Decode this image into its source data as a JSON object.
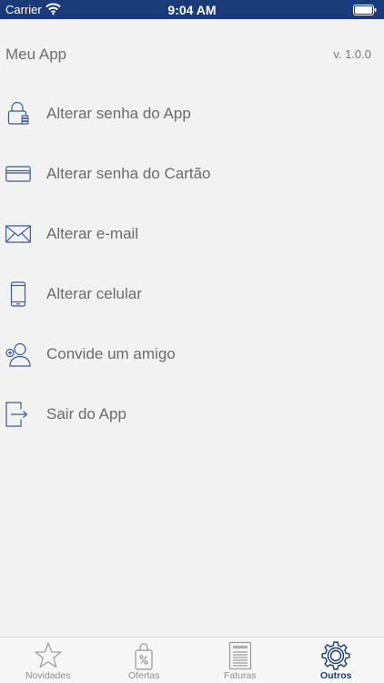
{
  "status_bar": {
    "carrier": "Carrier",
    "time": "9:04 AM"
  },
  "header": {
    "title": "Meu App",
    "version": "v. 1.0.0"
  },
  "menu": {
    "items": [
      {
        "label": "Alterar senha do App",
        "icon": "lock-icon"
      },
      {
        "label": "Alterar senha do Cartão",
        "icon": "credit-card-icon"
      },
      {
        "label": "Alterar e-mail",
        "icon": "envelope-icon"
      },
      {
        "label": "Alterar celular",
        "icon": "smartphone-icon"
      },
      {
        "label": "Convide um amigo",
        "icon": "add-user-icon"
      },
      {
        "label": "Sair do App",
        "icon": "logout-icon"
      }
    ]
  },
  "tab_bar": {
    "tabs": [
      {
        "label": "Novidades",
        "icon": "star-icon",
        "active": false
      },
      {
        "label": "Ofertas",
        "icon": "shopping-bag-percent-icon",
        "active": false
      },
      {
        "label": "Faturas",
        "icon": "invoice-icon",
        "active": false
      },
      {
        "label": "Outros",
        "icon": "gear-icon",
        "active": true
      }
    ]
  },
  "colors": {
    "primary": "#1b3a78",
    "background": "#f2f2f2",
    "text": "#6b6b6b",
    "icon_outline": "#3b5aa0",
    "tab_inactive": "#8e8e8e"
  }
}
